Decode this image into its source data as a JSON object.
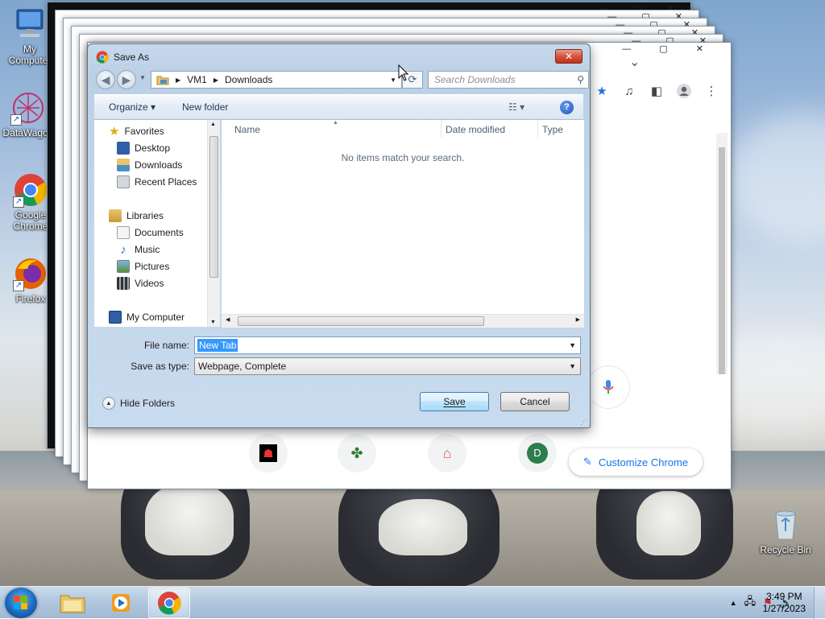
{
  "desktop": {
    "icons": [
      {
        "label": "My Computer",
        "name": "my-computer"
      },
      {
        "label": "DataWagon",
        "name": "datawagon"
      },
      {
        "label": "Google Chrome",
        "name": "google-chrome"
      },
      {
        "label": "Firefox",
        "name": "firefox"
      },
      {
        "label": "Recycle Bin",
        "name": "recycle-bin"
      }
    ]
  },
  "chrome": {
    "customize_label": "Customize Chrome",
    "shortcut_initial": "D",
    "tab_menu_glyph": "⌄",
    "window_controls": "— ▢ ✕"
  },
  "dialog": {
    "title": "Save As",
    "close_label": "✕",
    "breadcrumb": [
      "VM1",
      "Downloads"
    ],
    "search_placeholder": "Search Downloads",
    "organize_label": "Organize ▾",
    "new_folder_label": "New folder",
    "view_label": "☷ ▾",
    "help_label": "?",
    "nav": {
      "favorites": "Favorites",
      "desktop": "Desktop",
      "downloads": "Downloads",
      "recent": "Recent Places",
      "libraries": "Libraries",
      "documents": "Documents",
      "music": "Music",
      "pictures": "Pictures",
      "videos": "Videos",
      "computer": "My Computer"
    },
    "columns": {
      "name": "Name",
      "date": "Date modified",
      "type": "Type"
    },
    "empty_message": "No items match your search.",
    "file_name_label": "File name:",
    "file_name_value": "New Tab",
    "save_type_label": "Save as type:",
    "save_type_value": "Webpage, Complete",
    "hide_folders_label": "Hide Folders",
    "save_label": "Save",
    "cancel_label": "Cancel"
  },
  "taskbar": {
    "time": "3:49 PM",
    "date": "1/27/2023"
  }
}
